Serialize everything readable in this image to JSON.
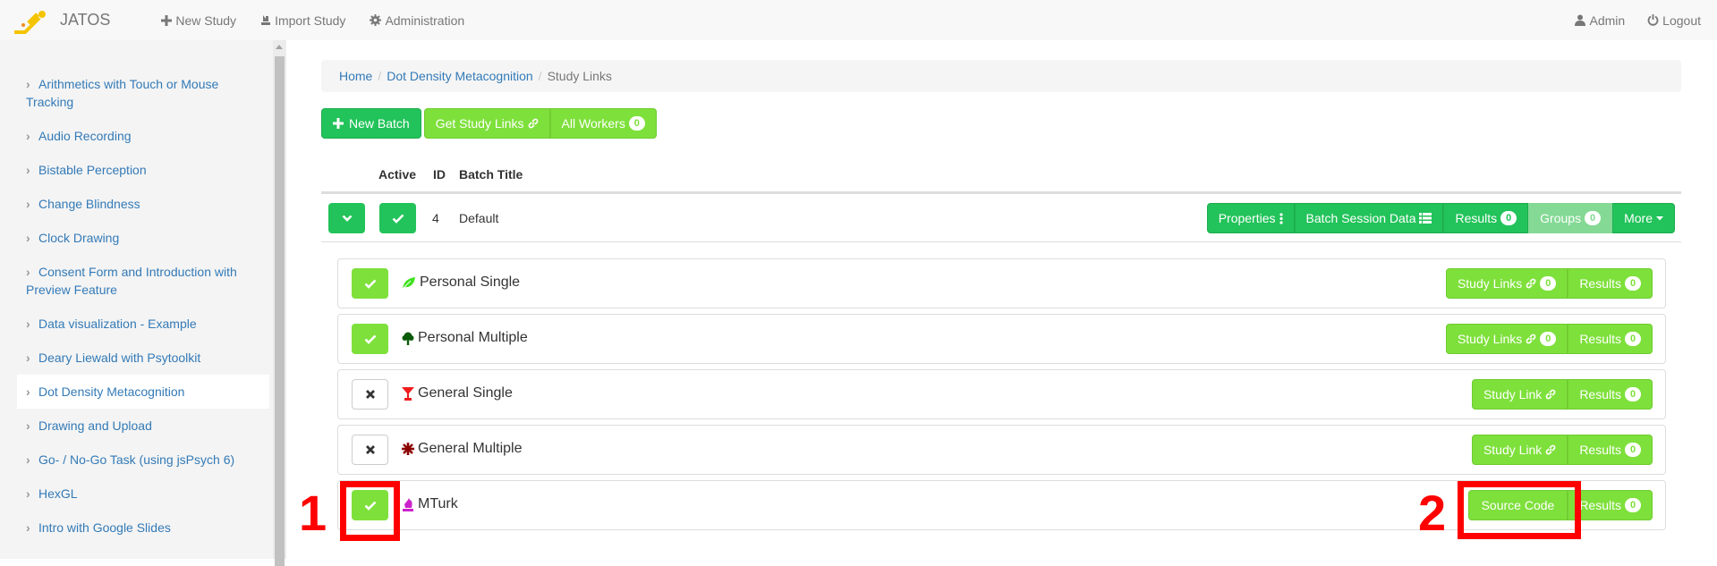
{
  "navbar": {
    "brand": "JATOS",
    "left_items": [
      {
        "label": "New Study",
        "icon": "plus-icon"
      },
      {
        "label": "Import Study",
        "icon": "import-icon"
      },
      {
        "label": "Administration",
        "icon": "gear-icon"
      }
    ],
    "right_items": [
      {
        "label": "Admin",
        "icon": "user-icon"
      },
      {
        "label": "Logout",
        "icon": "power-icon"
      }
    ]
  },
  "sidebar": {
    "items": [
      {
        "label": "Arithmetics with Touch or Mouse Tracking",
        "active": false
      },
      {
        "label": "Audio Recording",
        "active": false
      },
      {
        "label": "Bistable Perception",
        "active": false
      },
      {
        "label": "Change Blindness",
        "active": false
      },
      {
        "label": "Clock Drawing",
        "active": false
      },
      {
        "label": "Consent Form and Introduction with Preview Feature",
        "active": false
      },
      {
        "label": "Data visualization - Example",
        "active": false
      },
      {
        "label": "Deary Liewald with Psytoolkit",
        "active": false
      },
      {
        "label": "Dot Density Metacognition",
        "active": true
      },
      {
        "label": "Drawing and Upload",
        "active": false
      },
      {
        "label": "Go- / No-Go Task (using jsPsych 6)",
        "active": false
      },
      {
        "label": "HexGL",
        "active": false
      },
      {
        "label": "Intro with Google Slides",
        "active": false
      }
    ]
  },
  "breadcrumb": {
    "home": "Home",
    "study": "Dot Density Metacognition",
    "current": "Study Links",
    "separator": "/"
  },
  "toolbar": {
    "new_batch": "New Batch",
    "get_study_links": "Get Study Links",
    "all_workers": "All Workers",
    "all_workers_count": "0"
  },
  "batch_table": {
    "headers": {
      "active": "Active",
      "id": "ID",
      "title": "Batch Title"
    },
    "rows": [
      {
        "id": "4",
        "title": "Default",
        "active": true,
        "actions": {
          "properties": "Properties",
          "batch_session_data": "Batch Session Data",
          "results": "Results",
          "results_count": "0",
          "groups": "Groups",
          "groups_count": "0",
          "more": "More"
        }
      }
    ]
  },
  "study_link_types": [
    {
      "label": "Personal Single",
      "enabled": true,
      "icon": "leaf-icon",
      "icon_color": "#3ee21d",
      "link_label": "Study Links",
      "link_count": "0",
      "results_label": "Results",
      "results_count": "0"
    },
    {
      "label": "Personal Multiple",
      "enabled": true,
      "icon": "tree-icon",
      "icon_color": "#0a5a0a",
      "link_label": "Study Links",
      "link_count": "0",
      "results_label": "Results",
      "results_count": "0"
    },
    {
      "label": "General Single",
      "enabled": false,
      "icon": "glass-icon",
      "icon_color": "#ee1c1c",
      "link_label": "Study Link",
      "results_label": "Results",
      "results_count": "0"
    },
    {
      "label": "General Multiple",
      "enabled": false,
      "icon": "asterisk-icon",
      "icon_color": "#8b0000",
      "link_label": "Study Link",
      "results_label": "Results",
      "results_count": "0"
    },
    {
      "label": "MTurk",
      "enabled": true,
      "icon": "knight-icon",
      "icon_color": "#cc22cc",
      "link_label": "Source Code",
      "results_label": "Results",
      "results_count": "0"
    }
  ],
  "annotations": {
    "first": "1",
    "second": "2"
  },
  "colors": {
    "success": "#22c35a",
    "lime": "#7ee03b",
    "link": "#337ab7",
    "annotation": "#ff0000"
  }
}
